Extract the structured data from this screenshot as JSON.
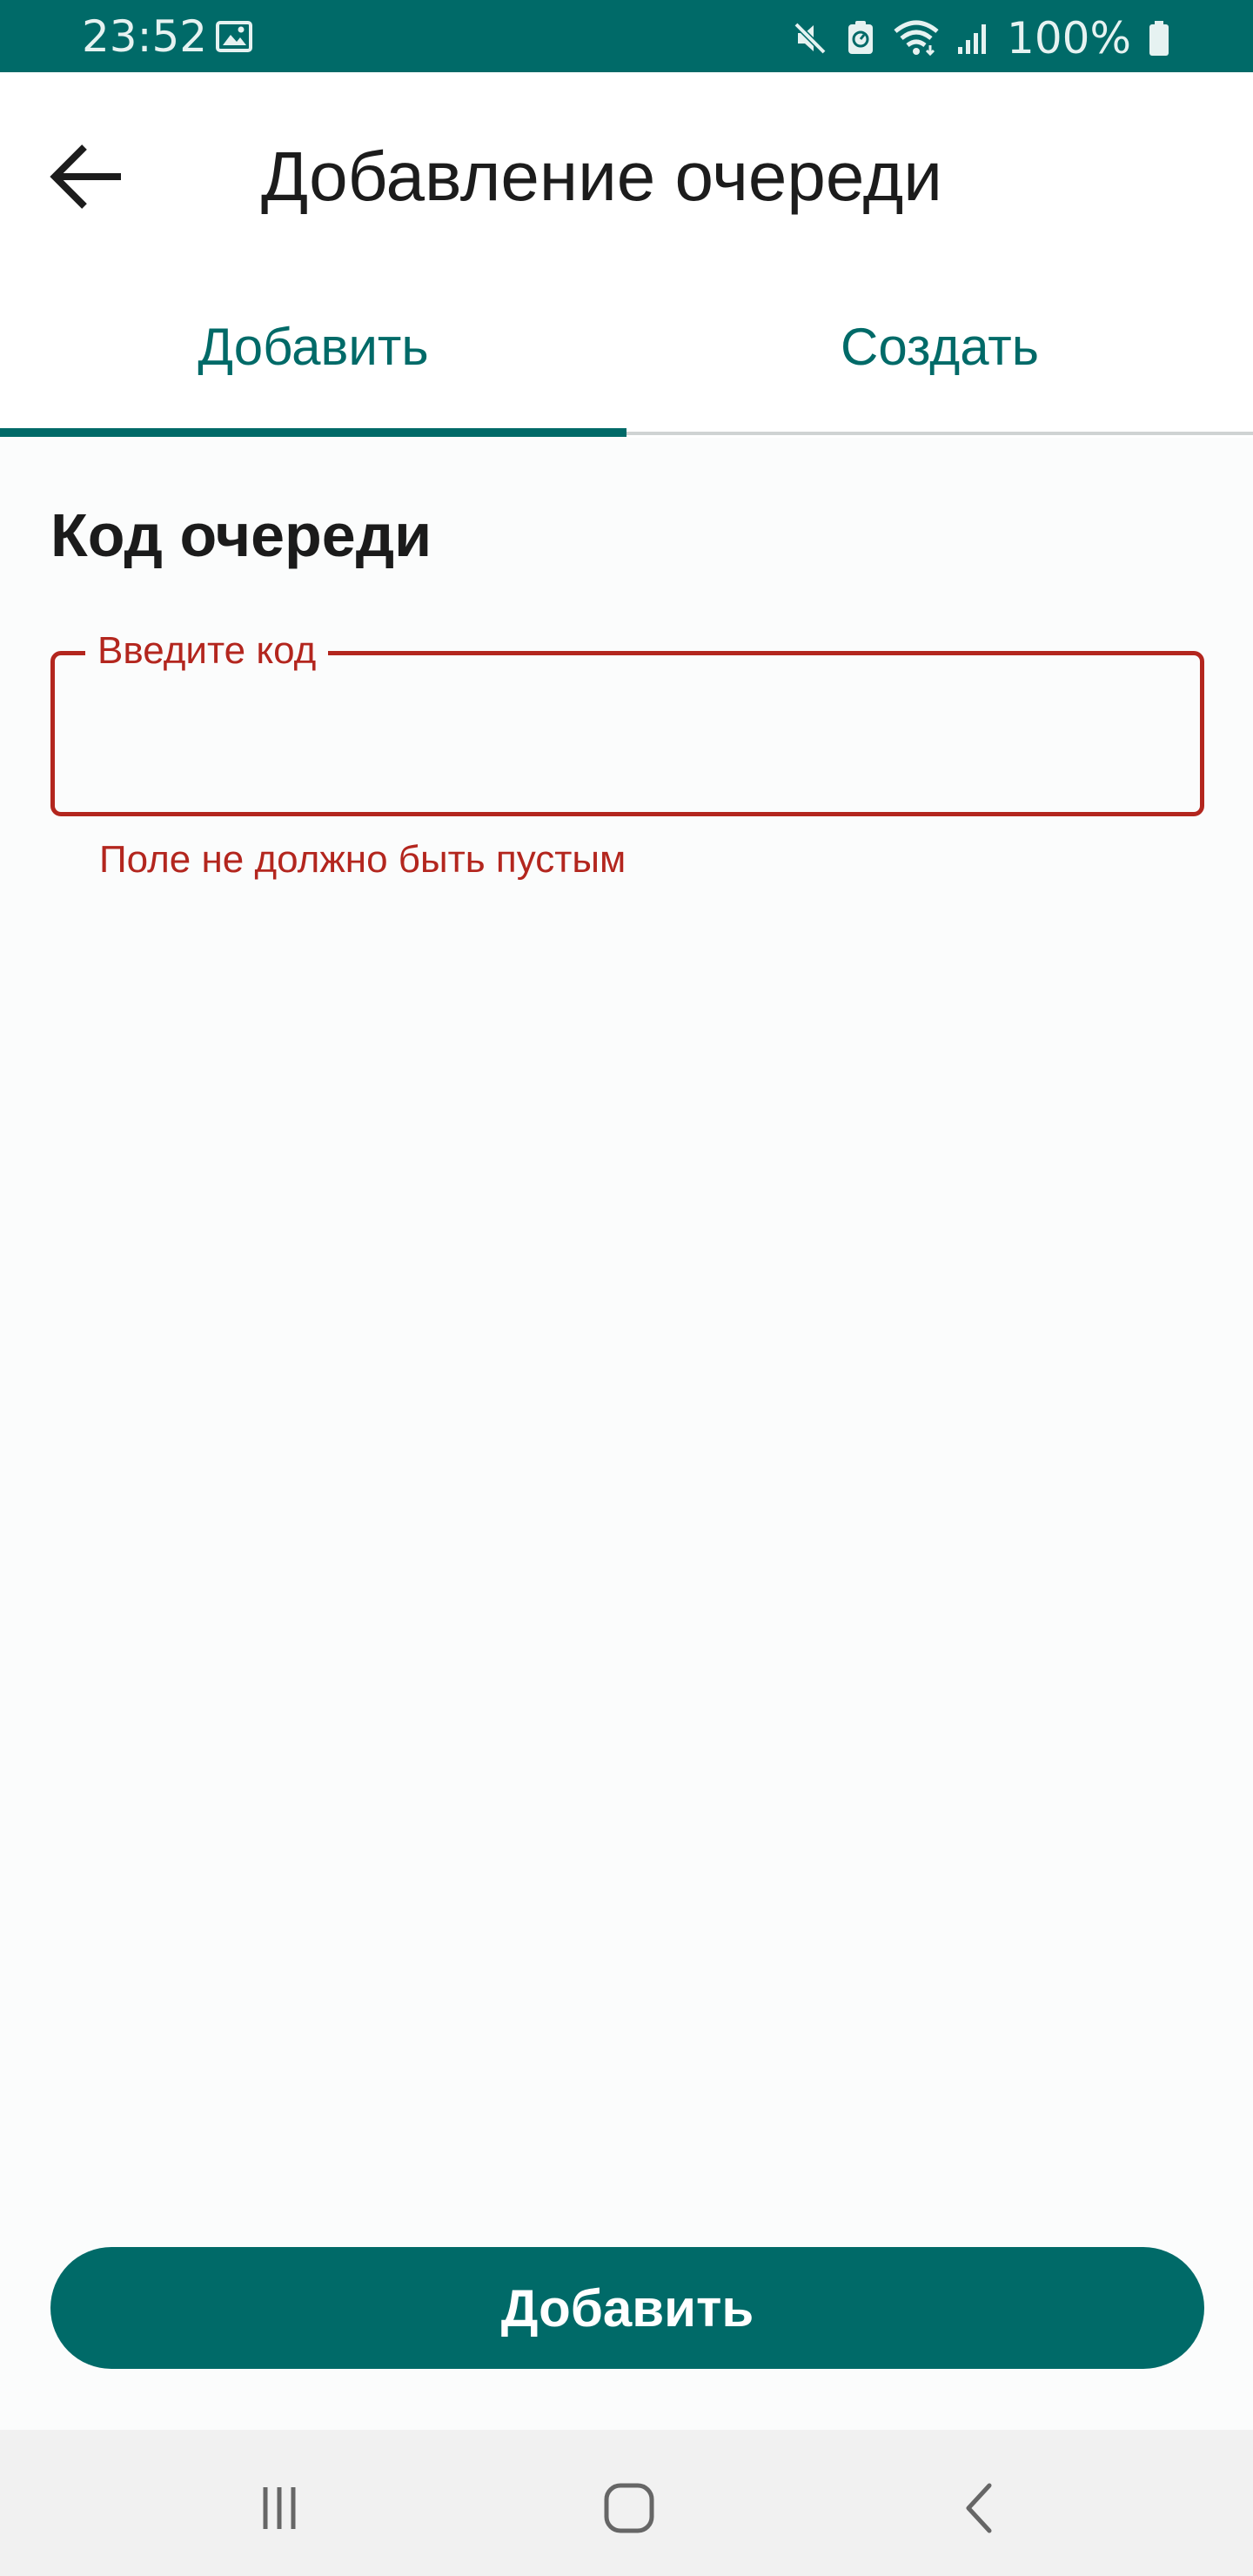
{
  "status_bar": {
    "time": "23:52",
    "battery": "100%",
    "icons": [
      "image-icon",
      "mute-icon",
      "data-saver-icon",
      "wifi-icon",
      "signal-icon",
      "battery-icon"
    ]
  },
  "app_bar": {
    "title": "Добавление очереди",
    "back_icon": "arrow-back-icon"
  },
  "tabs": [
    {
      "label": "Добавить",
      "selected": true
    },
    {
      "label": "Создать",
      "selected": false
    }
  ],
  "main": {
    "section_title": "Код очереди",
    "code_field": {
      "label": "Введите код",
      "value": "",
      "error": "Поле не должно быть пустым"
    },
    "add_button_label": "Добавить"
  },
  "nav_bar": {
    "icons": [
      "recent-apps-icon",
      "home-icon",
      "back-icon"
    ]
  },
  "colors": {
    "primary": "#006a68",
    "error": "#b3261e",
    "background": "#fbfcfc"
  }
}
